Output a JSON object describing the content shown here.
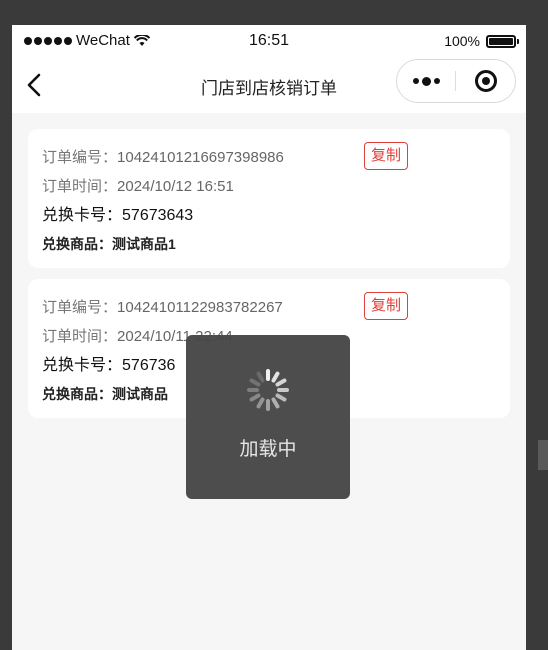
{
  "statusbar": {
    "carrier": "WeChat",
    "time": "16:51",
    "battery": "100%"
  },
  "navbar": {
    "title": "门店到店核销订单"
  },
  "orders": [
    {
      "order_no_label": "订单编号：",
      "order_no": "10424101216697398986",
      "order_time_label": "订单时间：",
      "order_time": "2024/10/12 16:51",
      "card_no_label": "兑换卡号：",
      "card_no": "57673643",
      "goods_label": "兑换商品：",
      "goods": "测试商品1",
      "copy_label": "复制"
    },
    {
      "order_no_label": "订单编号：",
      "order_no": "10424101122983782267",
      "order_time_label": "订单时间：",
      "order_time": "2024/10/11 22:44",
      "card_no_label": "兑换卡号：",
      "card_no": "576736",
      "goods_label": "兑换商品：",
      "goods": "测试商品",
      "copy_label": "复制"
    }
  ],
  "toast": {
    "text": "加载中",
    "icon": "loading-spinner-icon"
  },
  "colors": {
    "accent_red": "#e0403a",
    "page_bg": "#f6f6f6",
    "toast_bg": "#464646"
  }
}
